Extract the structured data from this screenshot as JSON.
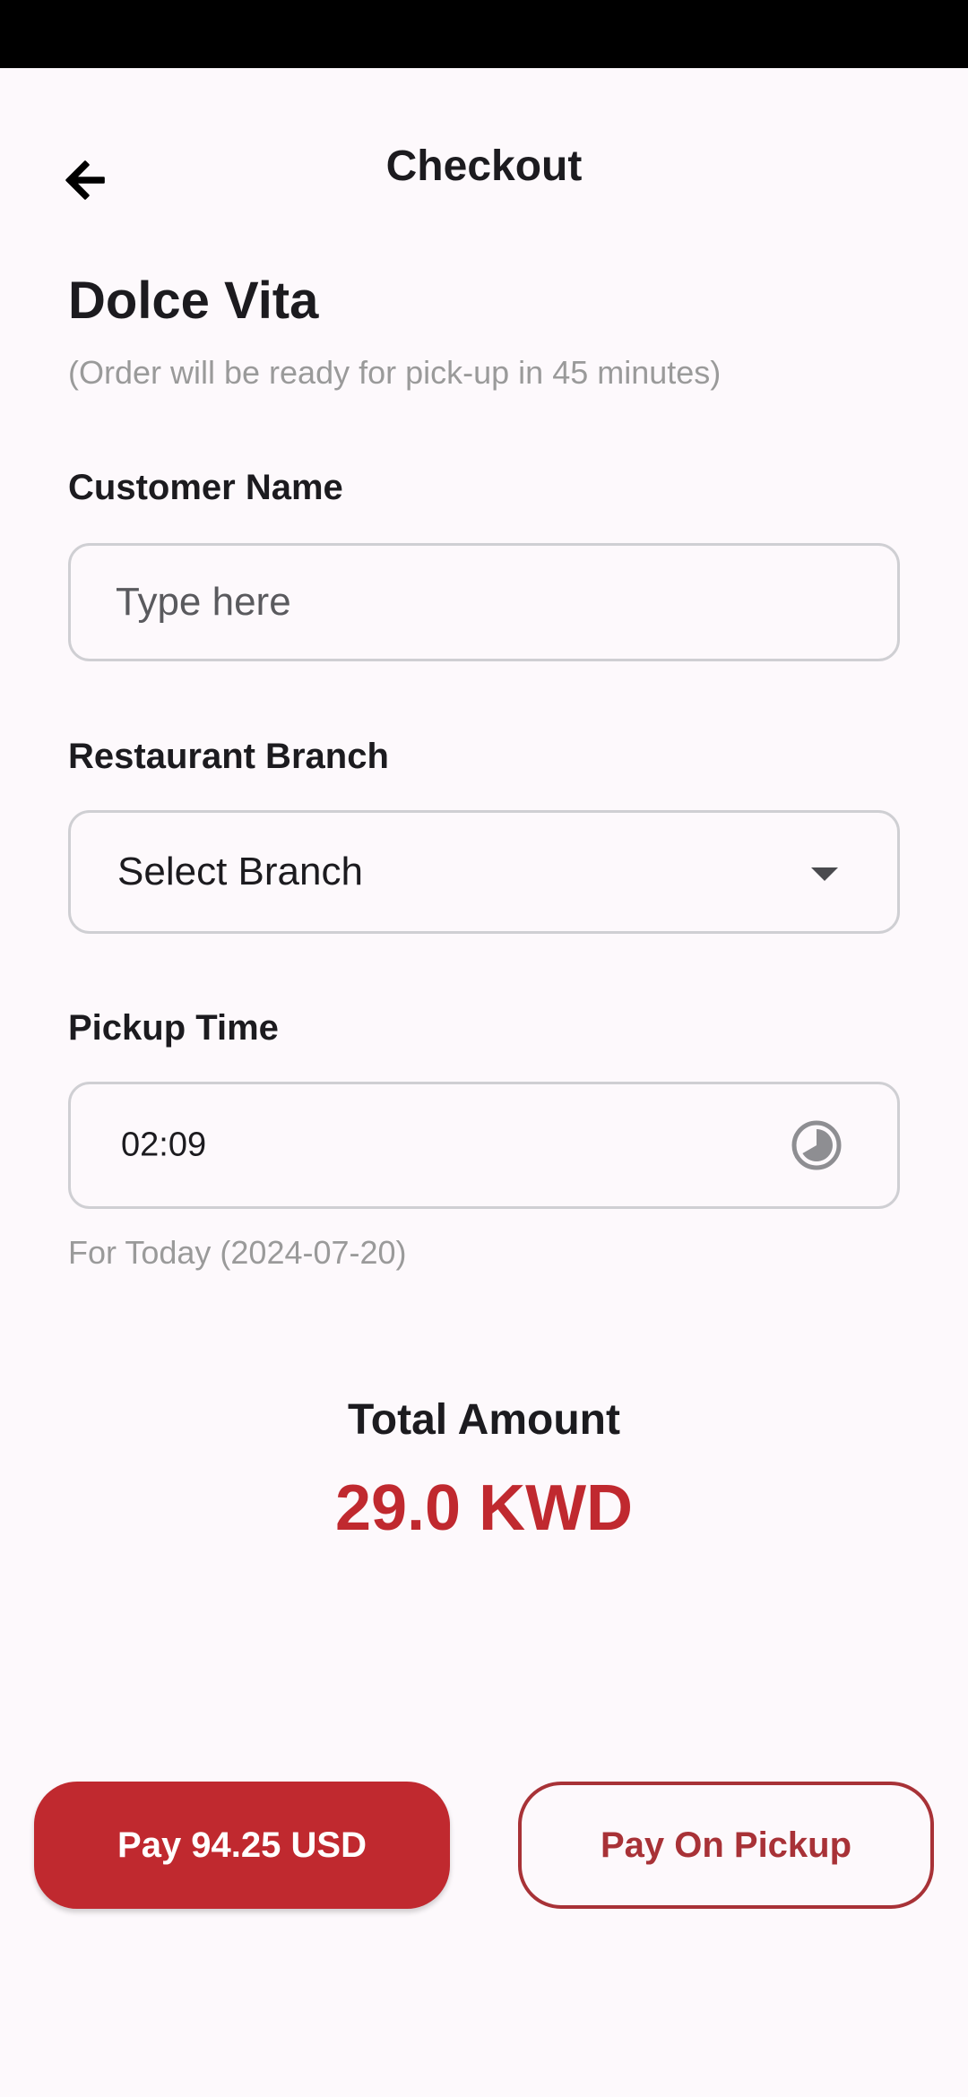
{
  "header": {
    "title": "Checkout",
    "back_icon": "arrow-left-icon"
  },
  "restaurant": {
    "name": "Dolce Vita",
    "ready_note": "(Order will be ready for pick-up in 45 minutes)"
  },
  "customer_name": {
    "label": "Customer Name",
    "value": "",
    "placeholder": "Type here"
  },
  "branch": {
    "label": "Restaurant Branch",
    "selected": "Select Branch",
    "icon": "dropdown-arrow-icon"
  },
  "pickup_time": {
    "label": "Pickup Time",
    "value": "02:09",
    "icon": "clock-icon",
    "date_note": "For Today (2024-07-20)"
  },
  "total": {
    "label": "Total Amount",
    "amount": "29.0 KWD"
  },
  "actions": {
    "pay_online_label": "Pay 94.25 USD",
    "pay_on_pickup_label": "Pay On Pickup"
  },
  "colors": {
    "accent": "#c0292f",
    "outline_accent": "#a83237",
    "background": "#fdf9fc",
    "status_bar": "#000000"
  }
}
